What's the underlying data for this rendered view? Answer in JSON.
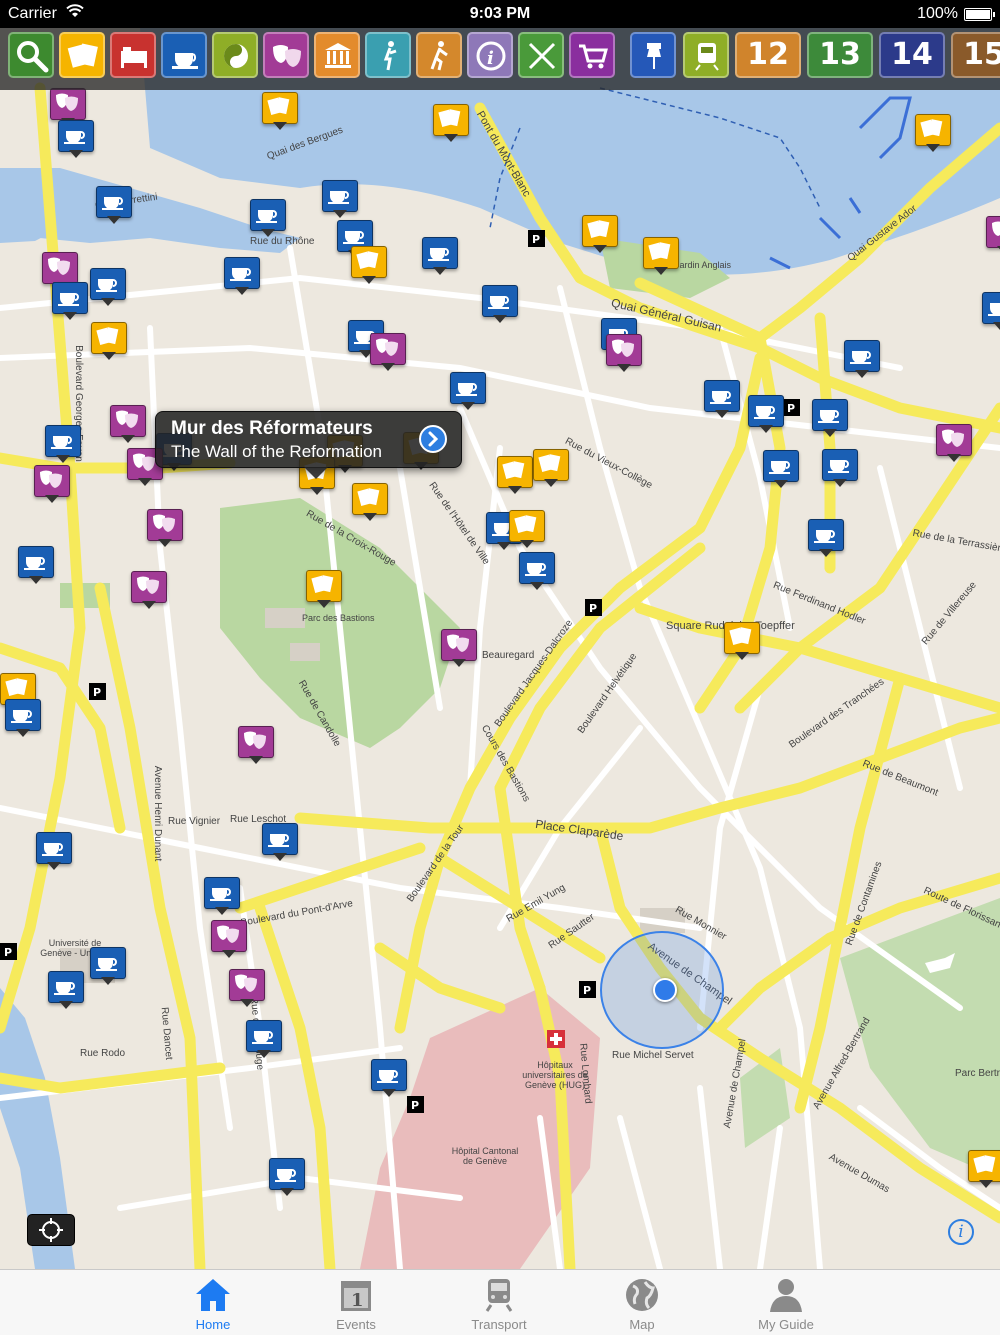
{
  "status_bar": {
    "carrier": "Carrier",
    "time": "9:03 PM",
    "battery": "100%"
  },
  "categories": {
    "icons": [
      "search-icon",
      "sights-icon",
      "hotel-icon",
      "cafe-icon",
      "wellness-icon",
      "theater-icon",
      "museum-icon",
      "nightlife-icon",
      "hiking-icon",
      "info-icon",
      "restaurant-icon",
      "shopping-icon",
      "pin-icon",
      "train-icon"
    ],
    "districts": [
      "12",
      "13",
      "14",
      "15"
    ]
  },
  "callout": {
    "title": "Mur des Réformateurs",
    "subtitle": "The Wall of the Reformation"
  },
  "map_labels": {
    "quai_general_guisan": "Quai Général Guisan",
    "pont_mont_blanc": "Pont du Mont-Blanc",
    "quai_gustave_ador": "Quai Gustave Ador",
    "rue_du_rhone": "Rue du Rhône",
    "rue_de_la_croix_rouge": "Rue de la Croix-Rouge",
    "parc_des_bastions": "Parc des Bastions",
    "boulevard_georges_favon": "Boulevard Georges Favon",
    "place_claparede": "Place Claparède",
    "boulevard_helvetique": "Boulevard Helvétique",
    "boulevard_jaques_dalcroze": "Boulevard Jacques-Dalcroze",
    "boulevard_des_tranchees": "Boulevard des Tranchées",
    "square_rudolphe_toepffer": "Square Rudolphe-Toepffer",
    "rue_ferdinand_hodler": "Rue Ferdinand Hodler",
    "avenue_henri_dunant": "Avenue Henri Dunant",
    "boulevard_du_pont_darve": "Boulevard du Pont-d'Arve",
    "boulevard_de_la_tour": "Boulevard de la Tour",
    "rue_de_lhotel_de_ville": "Rue de l'Hôtel de Ville",
    "rue_du_vieux_college": "Rue du Vieux-Collège",
    "hopitaux": "Hôpitaux universitaires de Genève (HUG)",
    "hopital_cantonal": "Hôpital Cantonal de Genève",
    "universite": "Université de Genève - UniMail",
    "avenue_de_champel": "Avenue de Champel",
    "rue_michel_servet": "Rue Michel Servet",
    "route_de_florissant": "Route de Florissant",
    "parc_bertrand": "Parc Bertrand",
    "rue_de_carouge": "Rue de Carouge",
    "rue_dancet": "Rue Dancet",
    "avenue_dumas": "Avenue Dumas",
    "rue_lombard": "Rue Lombard",
    "jardin_anglais": "Jardin Anglais",
    "rue_rodo": "Rue Rodo",
    "rue_vignier": "Rue Vignier",
    "rue_leschot": "Rue Leschot",
    "rue_emil_yung": "Rue Emil Yung",
    "rue_sautter": "Rue Sautter",
    "rue_monnier": "Rue Monnier",
    "avenue_de_champel_short": "Avenue de Champel",
    "beauregard": "Beauregard",
    "rue_de_candolle": "Rue de Candolle",
    "cours_des_bastions": "Cours des Bastions",
    "quai_turrettini": "Quai Turrettini",
    "quai_des_bergues": "Quai des Bergues",
    "rue_de_la_terrassiere": "Rue de la Terrassière",
    "rue_de_villereuse": "Rue de Villereuse",
    "avenue_alfred_bertrand": "Avenue Alfred-Bertrand",
    "rue_de_contamines": "Rue de Contamines",
    "rue_de_beaumont": "Rue de Beaumont"
  },
  "tabs": [
    {
      "label": "Home",
      "icon": "home-icon",
      "active": true
    },
    {
      "label": "Events",
      "icon": "calendar-icon",
      "active": false
    },
    {
      "label": "Transport",
      "icon": "train-icon",
      "active": false
    },
    {
      "label": "Map",
      "icon": "globe-icon",
      "active": false
    },
    {
      "label": "My Guide",
      "icon": "person-icon",
      "active": false
    }
  ],
  "colors": {
    "cafe": "#1a5fb4",
    "sight": "#f6b400",
    "theater": "#a23b96",
    "accent": "#1d7bf2",
    "road_major": "#f6ea5b",
    "water": "#a8c7e8",
    "park": "#b9d7a1"
  }
}
